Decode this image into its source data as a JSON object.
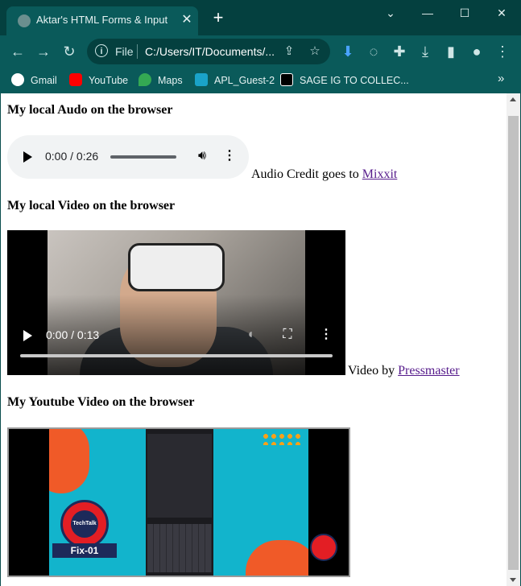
{
  "browser": {
    "tab_title": "Aktar's HTML Forms & Input",
    "tab_close": "✕",
    "new_tab": "+",
    "window_controls": {
      "dropdown": "⌄",
      "minimize": "—",
      "maximize": "☐",
      "close": "✕"
    },
    "omnibox": {
      "scheme_label": "File",
      "url": "C:/Users/IT/Documents/..."
    },
    "bookmarks": [
      {
        "label": "Gmail",
        "icon": "google-icon",
        "color": "#4285f4"
      },
      {
        "label": "YouTube",
        "icon": "youtube-icon",
        "color": "#ff0000"
      },
      {
        "label": "Maps",
        "icon": "maps-icon",
        "color": "#34a853"
      },
      {
        "label": "APL_Guest-2",
        "icon": "apl-icon",
        "color": "#1aa3c9"
      },
      {
        "label": "SAGE IG TO COLLEC...",
        "icon": "medium-icon",
        "color": "#000000"
      }
    ],
    "bookmarks_overflow": "»"
  },
  "page": {
    "audio_heading": "My local Audo on the browser",
    "audio_player": {
      "time": "0:00 / 0:26"
    },
    "audio_credit_prefix": "Audio Credit goes to ",
    "audio_credit_link": "Mixxit",
    "video_heading": "My local Video on the browser",
    "video_player": {
      "time": "0:00 / 0:13"
    },
    "video_credit_prefix": "Video by ",
    "video_credit_link": "Pressmaster",
    "youtube_heading": "My Youtube Video on the browser",
    "youtube_thumb": {
      "badge_text": "TechTalk",
      "ribbon_text": "Fix-01"
    }
  },
  "colors": {
    "chrome_dark": "#04403f",
    "chrome": "#0a5a5a",
    "link_visited": "#551a8b"
  }
}
